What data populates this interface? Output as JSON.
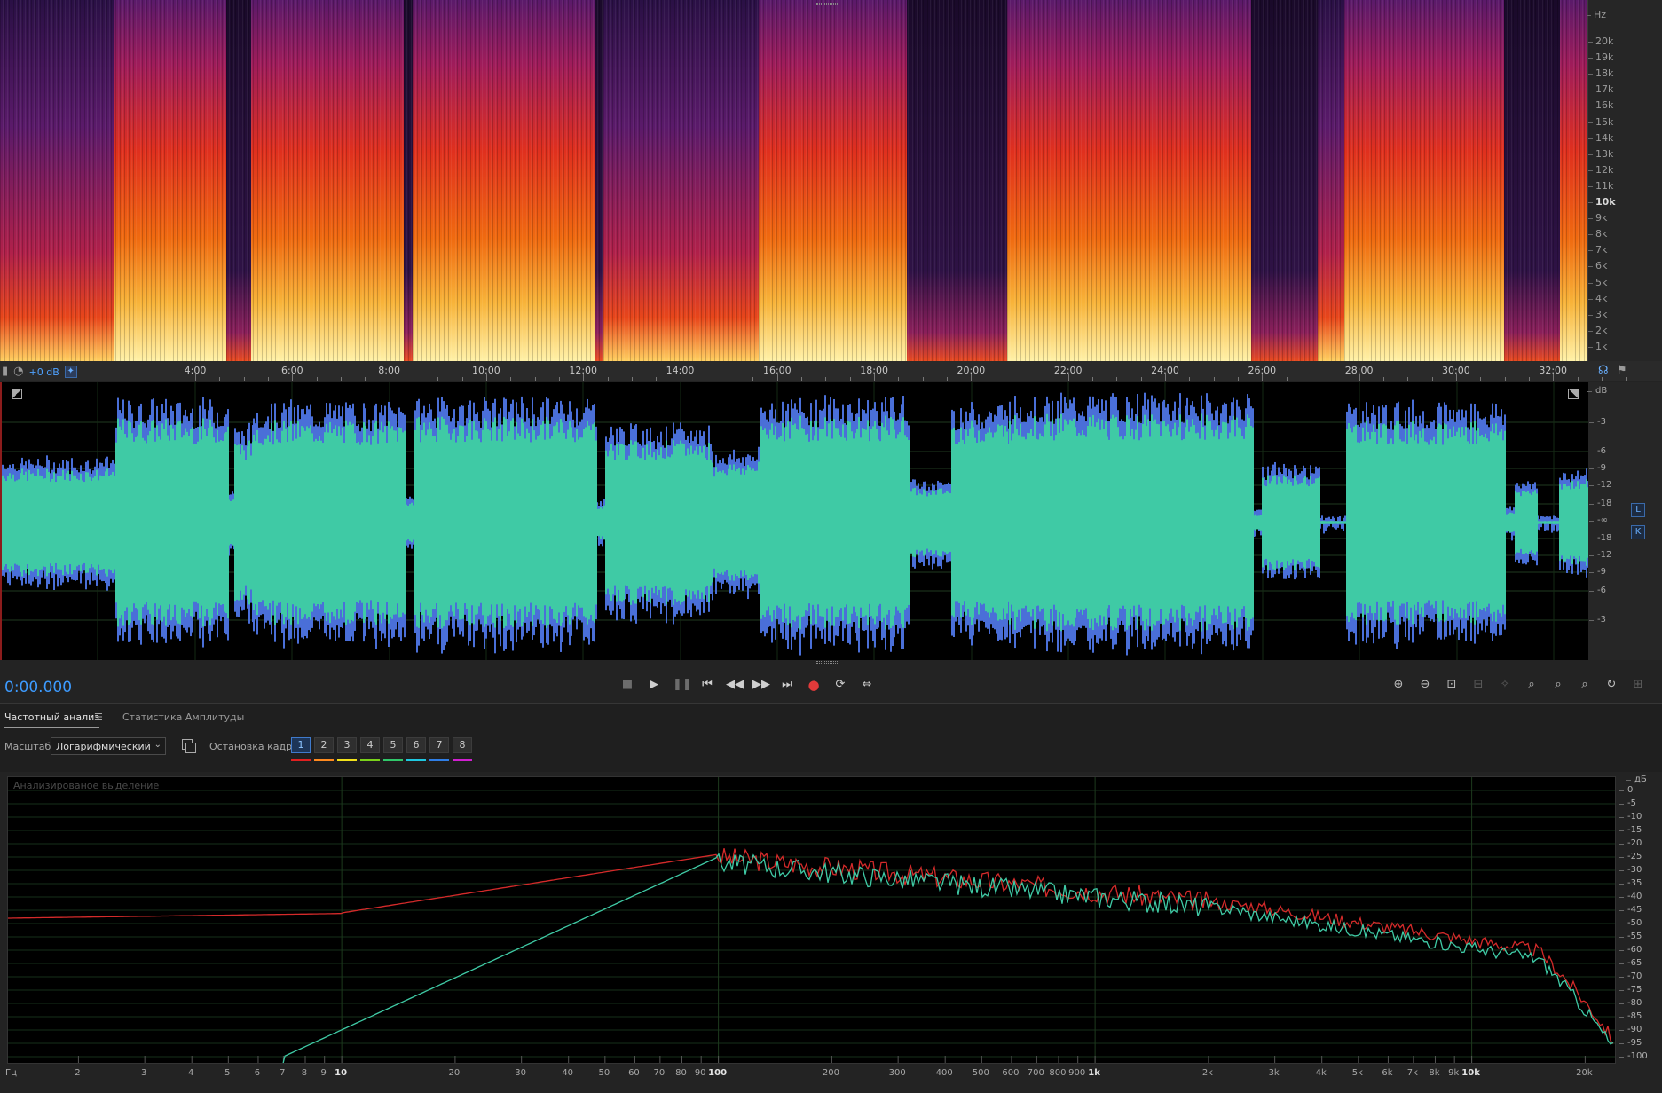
{
  "colors": {
    "accent": "#3d9bff",
    "wave_fill": "#3fcaa5",
    "wave_peak": "#4a6fd8",
    "record": "#e23a3a"
  },
  "spectral": {
    "unit": "Hz",
    "freq_ticks": [
      "20k",
      "19k",
      "18k",
      "17k",
      "16k",
      "15k",
      "14k",
      "13k",
      "12k",
      "11k",
      "10k",
      "9k",
      "8k",
      "7k",
      "6k",
      "5k",
      "4k",
      "3k",
      "2k",
      "1k"
    ]
  },
  "timeline": {
    "gain": "+0 dB",
    "labels": [
      "4:00",
      "6:00",
      "8:00",
      "10:00",
      "12:00",
      "14:00",
      "16:00",
      "18:00",
      "20:00",
      "22:00",
      "24:00",
      "26:00",
      "28:00",
      "30:00",
      "32:00"
    ]
  },
  "waveform": {
    "unit": "dB",
    "amp_ticks": [
      "-3",
      "-6",
      "-9",
      "-12",
      "-18",
      "-∞",
      "-18",
      "-12",
      "-9",
      "-6",
      "-3"
    ],
    "channel_l": "L",
    "channel_r": "K"
  },
  "transport": {
    "time": "0:00.000",
    "buttons": [
      "stop",
      "play",
      "pause",
      "go-to-start",
      "rewind",
      "fast-forward",
      "go-to-end",
      "record",
      "loop",
      "skip-selection"
    ]
  },
  "tabs": {
    "frequency": "Частотный анализ",
    "amplitude": "Статистика Амплитуды"
  },
  "controls": {
    "scale_label": "Масштаб:",
    "scale_value": "Логарифмический",
    "hold_label": "Остановка кадра:",
    "hold_buttons": [
      {
        "label": "1",
        "color": "#e02020"
      },
      {
        "label": "2",
        "color": "#ff8a1f"
      },
      {
        "label": "3",
        "color": "#f2e21b"
      },
      {
        "label": "4",
        "color": "#7ad21b"
      },
      {
        "label": "5",
        "color": "#30c86a"
      },
      {
        "label": "6",
        "color": "#1fc8e0"
      },
      {
        "label": "7",
        "color": "#2f7ee6"
      },
      {
        "label": "8",
        "color": "#d11fd1"
      }
    ]
  },
  "analysis": {
    "caption": "Анализированое выделение",
    "db_unit": "дБ",
    "db_ticks": [
      "0",
      "-5",
      "-10",
      "-15",
      "-20",
      "-25",
      "-30",
      "-35",
      "-40",
      "-45",
      "-50",
      "-55",
      "-60",
      "-65",
      "-70",
      "-75",
      "-80",
      "-85",
      "-90",
      "-95",
      "-100"
    ],
    "hz_unit": "Гц",
    "hz_ticks": [
      "2",
      "3",
      "4",
      "5",
      "6",
      "7",
      "8",
      "9",
      "10",
      "20",
      "30",
      "40",
      "50",
      "60",
      "70",
      "80",
      "90",
      "100",
      "200",
      "300",
      "400",
      "500",
      "600",
      "700",
      "800",
      "900",
      "1k",
      "2k",
      "3k",
      "4k",
      "5k",
      "6k",
      "7k",
      "8k",
      "9k",
      "10k",
      "20k"
    ]
  }
}
